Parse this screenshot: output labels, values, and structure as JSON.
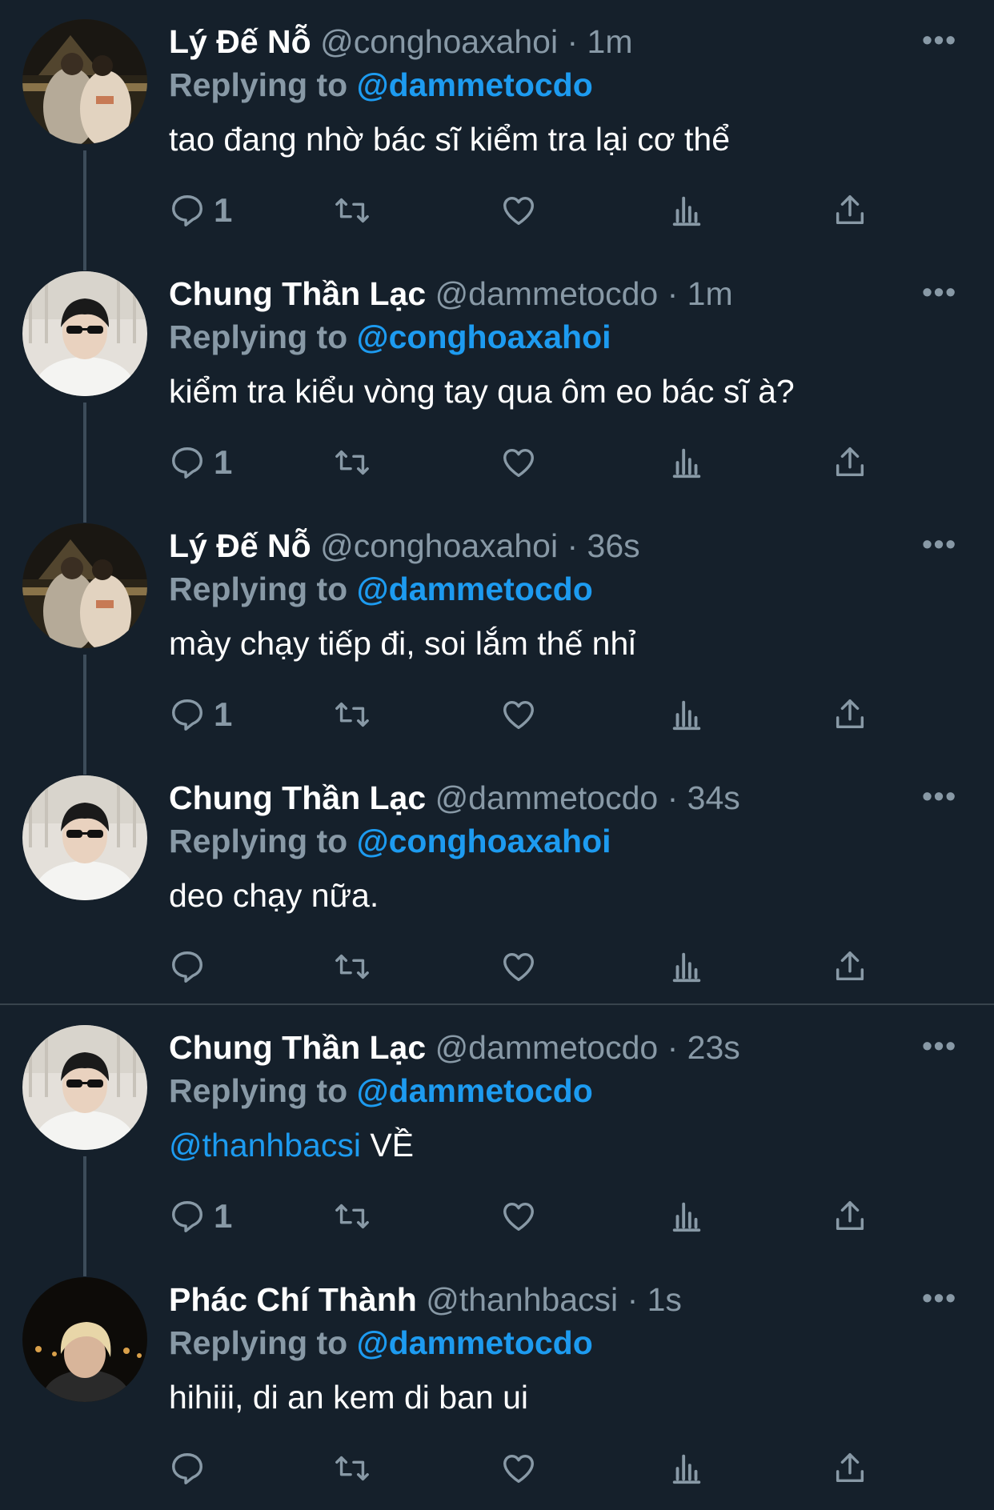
{
  "tweets": [
    {
      "name": "Lý Đế Nỗ",
      "handle": "@conghoaxahoi",
      "separator": "·",
      "time": "1m",
      "replying_label": "Replying to",
      "replying_to": "@dammetocdo",
      "text": "tao đang nhờ bác sĩ kiểm tra lại cơ thể",
      "mention": "",
      "reply_count": "1",
      "avatar": "avatar-photo-couple-night",
      "more_icon": "more-icon"
    },
    {
      "name": "Chung Thần Lạc",
      "handle": "@dammetocdo",
      "separator": "·",
      "time": "1m",
      "replying_label": "Replying to",
      "replying_to": "@conghoaxahoi",
      "text": "kiểm tra kiểu vòng tay qua ôm eo bác sĩ à?",
      "mention": "",
      "reply_count": "1",
      "avatar": "avatar-photo-sunglasses",
      "more_icon": "more-icon"
    },
    {
      "name": "Lý Đế Nỗ",
      "handle": "@conghoaxahoi",
      "separator": "·",
      "time": "36s",
      "replying_label": "Replying to",
      "replying_to": "@dammetocdo",
      "text": "mày chạy tiếp đi, soi lắm thế nhỉ",
      "mention": "",
      "reply_count": "1",
      "avatar": "avatar-photo-couple-night",
      "more_icon": "more-icon"
    },
    {
      "name": "Chung Thần Lạc",
      "handle": "@dammetocdo",
      "separator": "·",
      "time": "34s",
      "replying_label": "Replying to",
      "replying_to": "@conghoaxahoi",
      "text": "deo chạy nữa.",
      "mention": "",
      "reply_count": "",
      "avatar": "avatar-photo-sunglasses",
      "more_icon": "more-icon"
    },
    {
      "name": "Chung Thần Lạc",
      "handle": "@dammetocdo",
      "separator": "·",
      "time": "23s",
      "replying_label": "Replying to",
      "replying_to": "@dammetocdo",
      "text": " VỀ",
      "mention": "@thanhbacsi",
      "reply_count": "1",
      "avatar": "avatar-photo-sunglasses",
      "more_icon": "more-icon"
    },
    {
      "name": "Phác Chí Thành",
      "handle": "@thanhbacsi",
      "separator": "·",
      "time": "1s",
      "replying_label": "Replying to",
      "replying_to": "@dammetocdo",
      "text": "hihiii, di an kem di ban ui",
      "mention": "",
      "reply_count": "",
      "avatar": "avatar-photo-blonde-night",
      "more_icon": "more-icon"
    }
  ],
  "colors": {
    "background": "#15202b",
    "muted": "#8899a6",
    "link": "#1d9bf0",
    "thread_line": "#3d4c5a",
    "divider": "#38444d"
  }
}
